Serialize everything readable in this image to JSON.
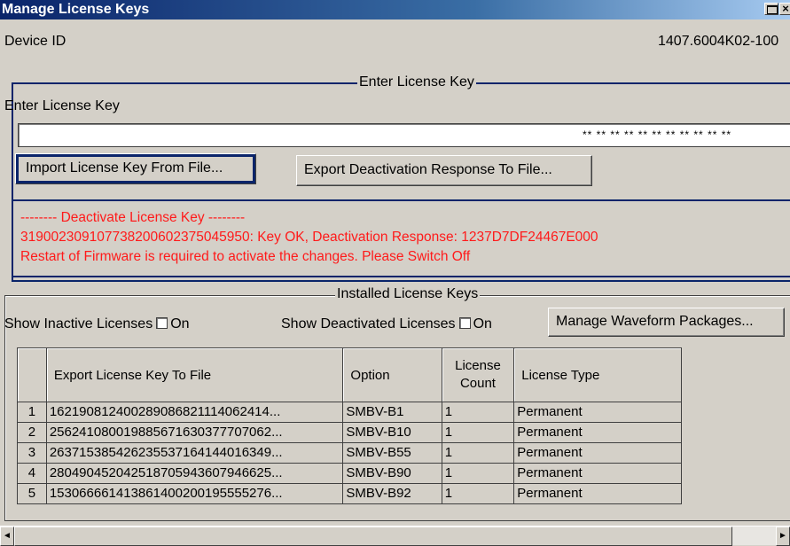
{
  "window": {
    "title": "Manage License Keys"
  },
  "device": {
    "label": "Device ID",
    "value": "1407.6004K02-100"
  },
  "enter_group": {
    "title": "Enter License Key",
    "field_label": "Enter License Key",
    "field_value": "** ** ** ** ** ** ** ** ** ** **",
    "import_button": "Import License Key From File...",
    "export_button": "Export Deactivation Response To File..."
  },
  "message": {
    "color": "#ff1a1a",
    "line1": "-------- Deactivate License Key --------",
    "line2": "319002309107738200602375045950: Key OK, Deactivation Response: 1237D7DF24467E000",
    "line3": "Restart of Firmware is required to activate the changes. Please Switch Off"
  },
  "installed_group": {
    "title": "Installed License Keys",
    "show_inactive_label": "Show Inactive Licenses",
    "show_inactive_on": "On",
    "show_deactivated_label": "Show Deactivated Licenses",
    "show_deactivated_on": "On",
    "waveform_button": "Manage Waveform Packages..."
  },
  "table": {
    "headers": {
      "key": "Export License Key To File",
      "option": "Option",
      "count_line1": "License",
      "count_line2": "Count",
      "type": "License Type"
    },
    "rows": [
      {
        "idx": "1",
        "key": "162190812400289086821114062414...",
        "option": "SMBV-B1",
        "count": "1",
        "type": "Permanent"
      },
      {
        "idx": "2",
        "key": "256241080019885671630377707062...",
        "option": "SMBV-B10",
        "count": "1",
        "type": "Permanent"
      },
      {
        "idx": "3",
        "key": "263715385426235537164144016349...",
        "option": "SMBV-B55",
        "count": "1",
        "type": "Permanent"
      },
      {
        "idx": "4",
        "key": "280490452042518705943607946625...",
        "option": "SMBV-B90",
        "count": "1",
        "type": "Permanent"
      },
      {
        "idx": "5",
        "key": "153066661413861400200195555276...",
        "option": "SMBV-B92",
        "count": "1",
        "type": "Permanent"
      }
    ]
  },
  "scrollbar": {
    "left_arrow": "◄",
    "right_arrow": "►"
  }
}
